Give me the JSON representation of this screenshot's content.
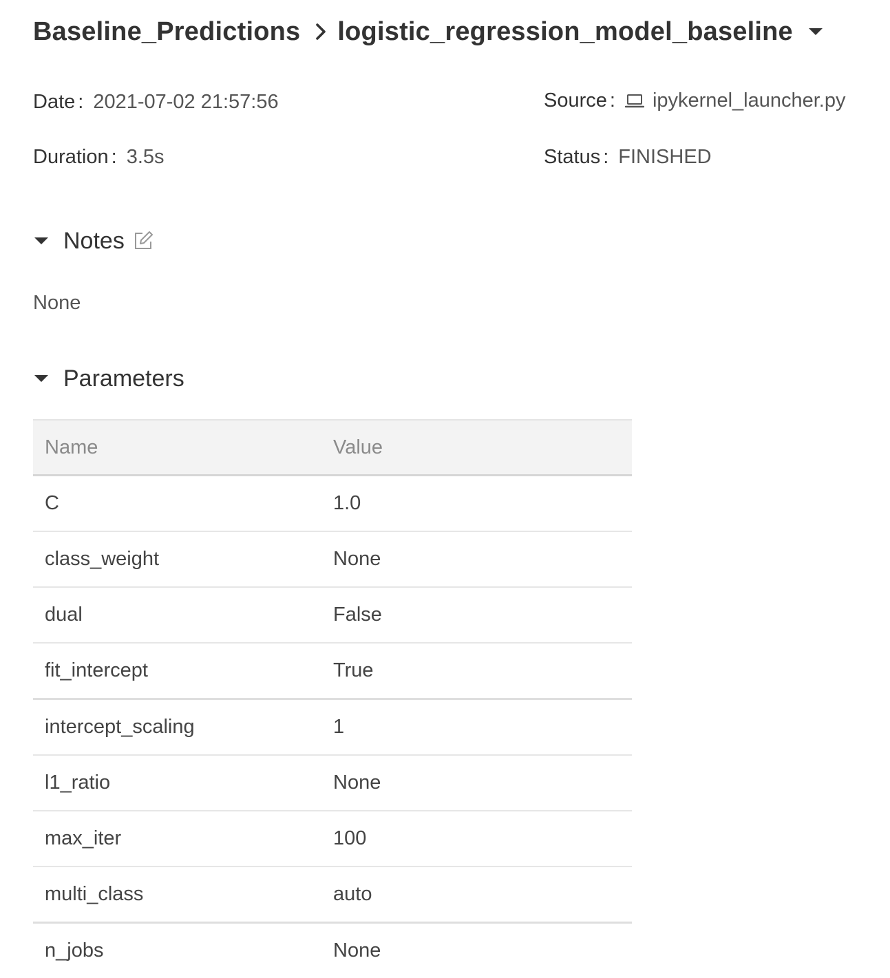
{
  "breadcrumb": {
    "experiment": "Baseline_Predictions",
    "separator_icon": "chevron-right-icon",
    "run": "logistic_regression_model_baseline",
    "dropdown_icon": "caret-down-icon"
  },
  "meta": {
    "date_label": "Date",
    "date_value": "2021-07-02 21:57:56",
    "duration_label": "Duration",
    "duration_value": "3.5s",
    "source_label": "Source",
    "source_icon": "laptop-icon",
    "source_value": "ipykernel_launcher.py",
    "status_label": "Status",
    "status_value": "FINISHED"
  },
  "notes": {
    "title": "Notes",
    "edit_icon": "edit-icon",
    "content": "None"
  },
  "parameters": {
    "title": "Parameters",
    "columns": [
      "Name",
      "Value"
    ],
    "rows": [
      {
        "name": "C",
        "value": "1.0"
      },
      {
        "name": "class_weight",
        "value": "None"
      },
      {
        "name": "dual",
        "value": "False"
      },
      {
        "name": "fit_intercept",
        "value": "True"
      },
      {
        "name": "intercept_scaling",
        "value": "1"
      },
      {
        "name": "l1_ratio",
        "value": "None"
      },
      {
        "name": "max_iter",
        "value": "100"
      },
      {
        "name": "multi_class",
        "value": "auto"
      },
      {
        "name": "n_jobs",
        "value": "None"
      }
    ]
  },
  "colors": {
    "text": "#333333",
    "muted": "#8a8a8a",
    "header_bg": "#f3f3f3",
    "border": "#e6e6e6"
  }
}
